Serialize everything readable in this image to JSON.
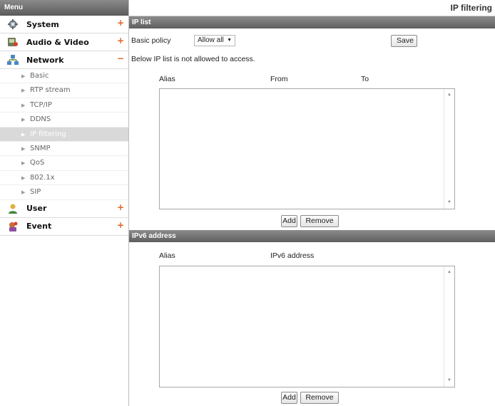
{
  "sidebar": {
    "header": "Menu",
    "groups": {
      "system": {
        "label": "System",
        "toggle": "+"
      },
      "audio_video": {
        "label": "Audio & Video",
        "toggle": "+"
      },
      "network": {
        "label": "Network",
        "toggle": "−"
      },
      "user": {
        "label": "User",
        "toggle": "+"
      },
      "event": {
        "label": "Event",
        "toggle": "+"
      }
    },
    "network_items": [
      "Basic",
      "RTP stream",
      "TCP/IP",
      "DDNS",
      "IP filtering",
      "SNMP",
      "QoS",
      "802.1x",
      "SIP"
    ],
    "active_item": "IP filtering"
  },
  "page": {
    "title": "IP filtering"
  },
  "ip_list": {
    "section_title": "IP list",
    "policy_label": "Basic policy",
    "policy_value": "Allow all",
    "save_label": "Save",
    "note": "Below IP list is not allowed to access.",
    "columns": {
      "alias": "Alias",
      "from": "From",
      "to": "To"
    },
    "add_label": "Add",
    "remove_label": "Remove"
  },
  "ipv6": {
    "section_title": "IPv6 address",
    "columns": {
      "alias": "Alias",
      "address": "IPv6 address"
    },
    "add_label": "Add",
    "remove_label": "Remove"
  }
}
